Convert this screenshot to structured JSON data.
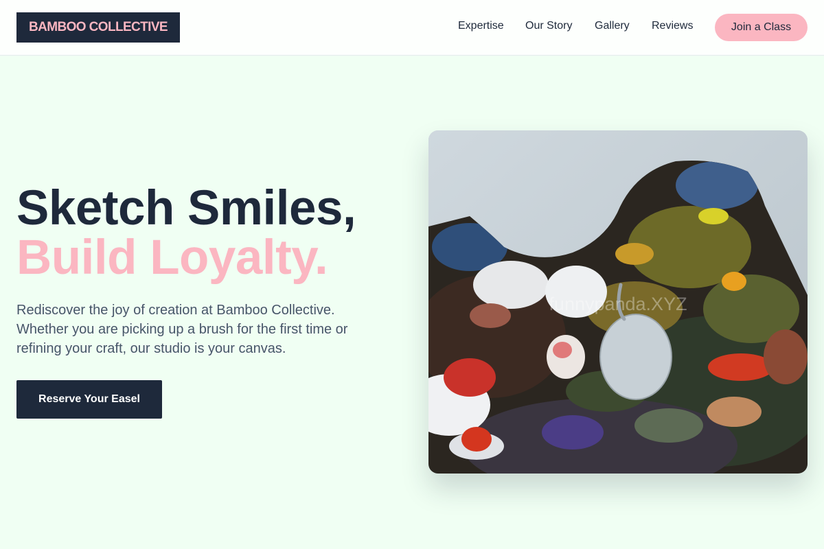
{
  "brand": {
    "logo_text": "BAMBOO COLLECTIVE"
  },
  "nav": {
    "links": [
      {
        "label": "Expertise"
      },
      {
        "label": "Our Story"
      },
      {
        "label": "Gallery"
      },
      {
        "label": "Reviews"
      }
    ],
    "cta_label": "Join a Class"
  },
  "hero": {
    "headline_line1": "Sketch Smiles,",
    "headline_line2": "Build Loyalty.",
    "description": "Rediscover the joy of creation at Bamboo Collective. Whether you are picking up a brush for the first time or refining your craft, our studio is your canvas.",
    "cta_label": "Reserve Your Easel",
    "image": {
      "subject": "paint-palette-photo",
      "watermark": "funnypanda.XYZ"
    }
  },
  "colors": {
    "page_bg": "#f0fff3",
    "navy": "#1e293b",
    "accent_pink": "#fbb6c1",
    "body_text": "#475569"
  }
}
